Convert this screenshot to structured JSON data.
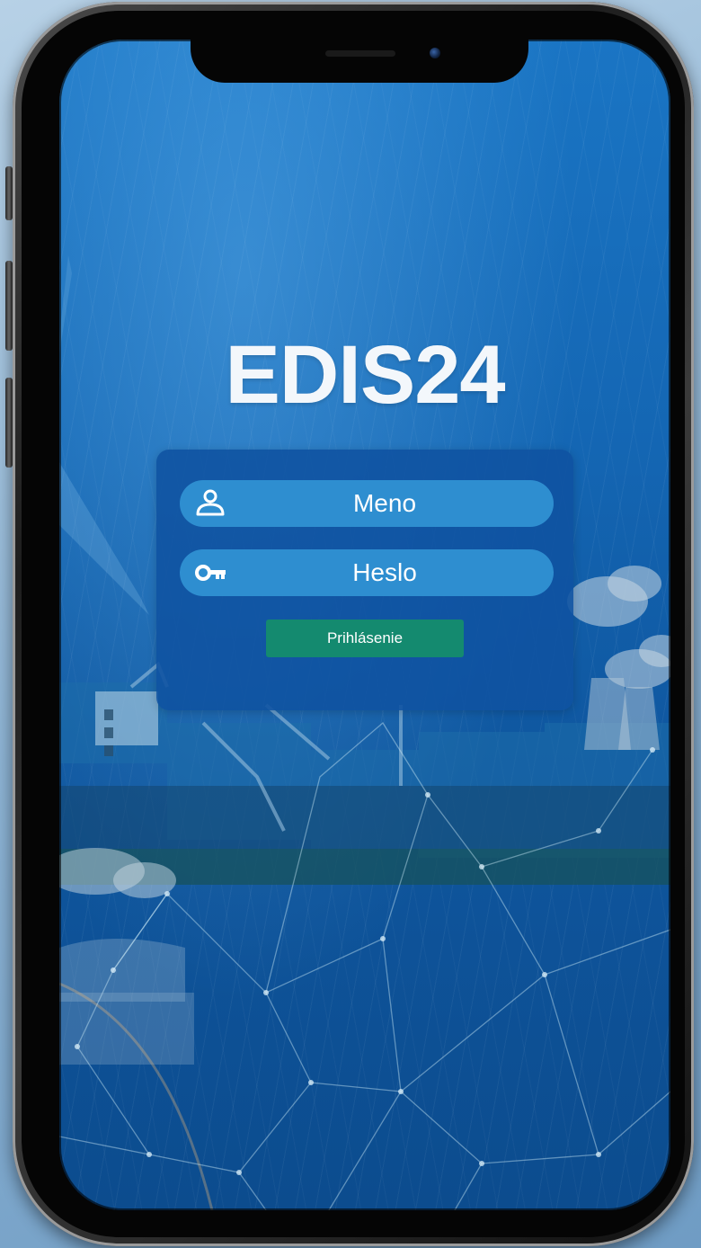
{
  "app": {
    "logo_text": "EDIS24"
  },
  "login": {
    "username_placeholder": "Meno",
    "password_placeholder": "Heslo",
    "submit_label": "Prihlásenie"
  },
  "icons": {
    "username": "user-icon",
    "password": "key-icon"
  },
  "colors": {
    "screen_background": "#1466b3",
    "card_background": "#0f52a0",
    "field_background": "#2e8ed0",
    "button_background": "#148a6f",
    "text": "#ffffff"
  }
}
